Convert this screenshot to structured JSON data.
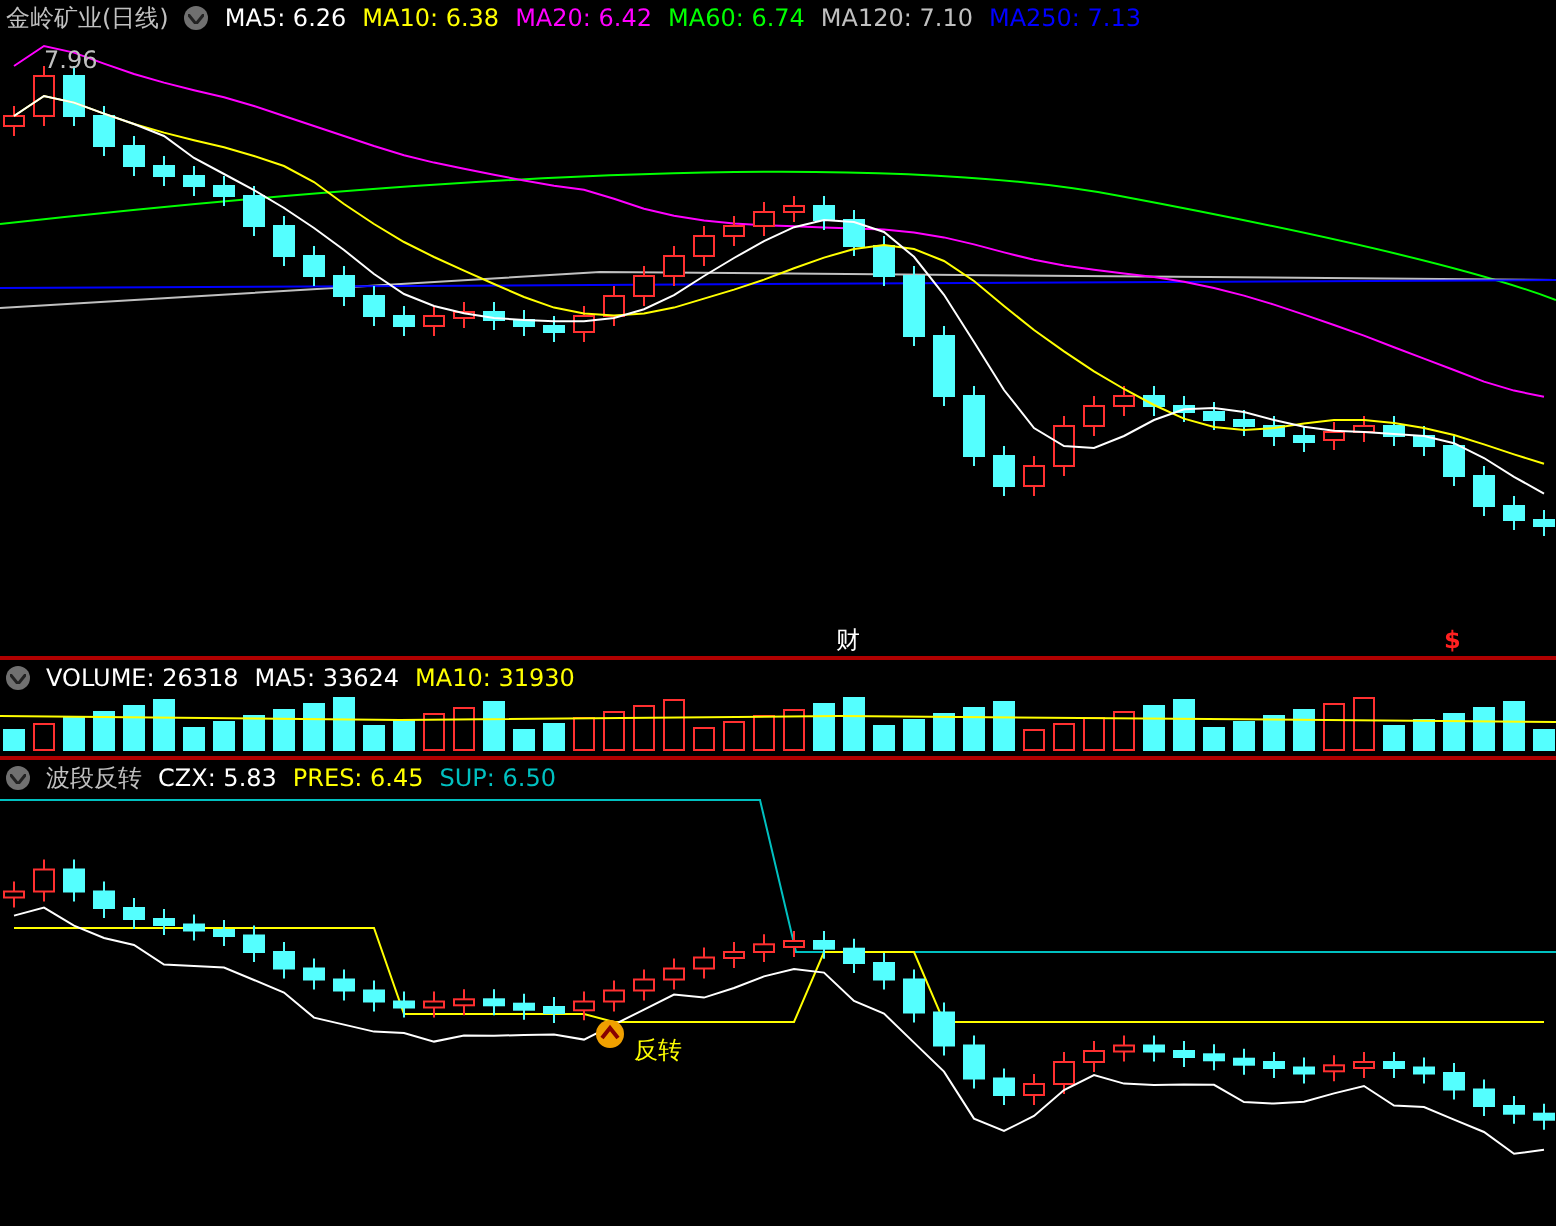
{
  "main_panel": {
    "title": "金岭矿业(日线)",
    "legend": [
      {
        "label": "MA5: 6.26",
        "color": "#ffffff"
      },
      {
        "label": "MA10: 6.38",
        "color": "#ffff00"
      },
      {
        "label": "MA20: 6.42",
        "color": "#ff00ff"
      },
      {
        "label": "MA60: 6.74",
        "color": "#00ff00"
      },
      {
        "label": "MA120: 7.10",
        "color": "#c0c0c0"
      },
      {
        "label": "MA250: 7.13",
        "color": "#0000ff"
      }
    ],
    "high_label": "7.96",
    "markers": [
      "财",
      "$"
    ]
  },
  "volume_panel": {
    "legend": [
      {
        "label": "VOLUME: 26318",
        "color": "#ffffff"
      },
      {
        "label": "MA5: 33624",
        "color": "#ffffff"
      },
      {
        "label": "MA10: 31930",
        "color": "#ffff00"
      }
    ]
  },
  "indicator_panel": {
    "title": "波段反转",
    "legend": [
      {
        "label": "CZX: 5.83",
        "color": "#ffffff"
      },
      {
        "label": "PRES: 6.45",
        "color": "#ffff00"
      },
      {
        "label": "SUP: 6.50",
        "color": "#00c0c0"
      }
    ],
    "signal_label": "反转"
  }
}
